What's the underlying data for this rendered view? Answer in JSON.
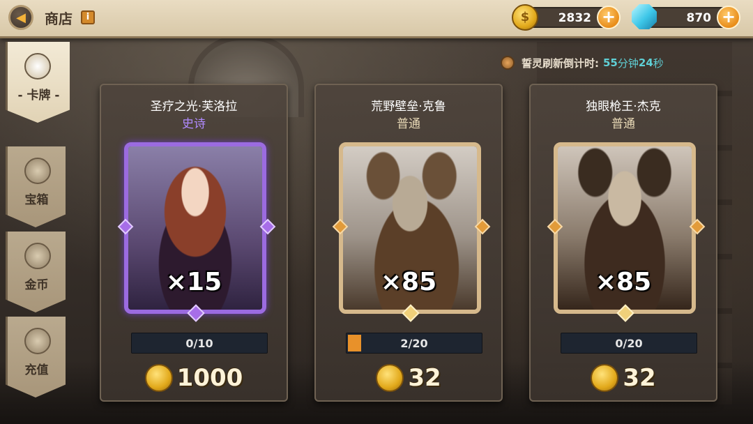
{
  "header": {
    "title": "商店",
    "back_icon": "back-arrow-icon",
    "info_icon": "info-icon"
  },
  "resources": {
    "gold": {
      "value": "2832",
      "icon": "gold-coin-icon"
    },
    "gem": {
      "value": "870",
      "icon": "blue-gem-icon"
    }
  },
  "timer": {
    "label": "誓灵刷新倒计时:",
    "minutes": "55",
    "minutes_unit": "分钟",
    "seconds": "24",
    "seconds_unit": "秒"
  },
  "sidebar": {
    "items": [
      {
        "label": "卡牌",
        "icon": "cards-icon",
        "active": true
      },
      {
        "label": "宝箱",
        "icon": "chest-icon",
        "active": false
      },
      {
        "label": "金币",
        "icon": "coin-icon",
        "active": false
      },
      {
        "label": "充值",
        "icon": "recharge-icon",
        "active": false
      }
    ]
  },
  "cards": [
    {
      "name": "圣疗之光·芙洛拉",
      "rarity": "史诗",
      "rarity_color": "#b08aff",
      "quantity": "×15",
      "progress_text": "0/10",
      "progress_value": 0.0,
      "price": "1000"
    },
    {
      "name": "荒野壁垒·克鲁",
      "rarity": "普通",
      "rarity_color": "#e8d9b6",
      "quantity": "×85",
      "progress_text": "2/20",
      "progress_value": 0.1,
      "price": "32"
    },
    {
      "name": "独眼枪王·杰克",
      "rarity": "普通",
      "rarity_color": "#e8d9b6",
      "quantity": "×85",
      "progress_text": "0/20",
      "progress_value": 0.0,
      "price": "32"
    }
  ],
  "colors": {
    "accent_orange": "#e8912a",
    "timer_cyan": "#5fd0d6",
    "epic_purple": "#9b6be0"
  }
}
